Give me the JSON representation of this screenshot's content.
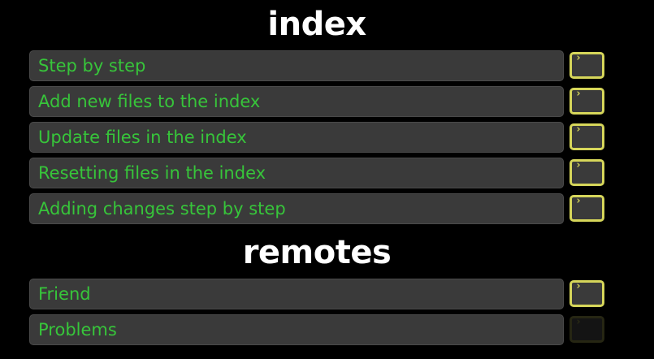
{
  "sections": [
    {
      "title": "index",
      "levels": [
        {
          "label": "Step by step",
          "enabled": true
        },
        {
          "label": "Add new files to the index",
          "enabled": true
        },
        {
          "label": "Update files in the index",
          "enabled": true
        },
        {
          "label": "Resetting files in the index",
          "enabled": true
        },
        {
          "label": "Adding changes step by step",
          "enabled": true
        }
      ]
    },
    {
      "title": "remotes",
      "levels": [
        {
          "label": "Friend",
          "enabled": true
        },
        {
          "label": "Problems",
          "enabled": false
        }
      ]
    }
  ],
  "icons": {
    "terminal": "terminal-icon",
    "prompt_glyph": "›"
  },
  "colors": {
    "background": "#000000",
    "level_bg": "#3a3a3a",
    "level_text": "#37c53a",
    "title_text": "#ffffff",
    "terminal_border": "#d6d65a",
    "terminal_disabled": "#141414"
  }
}
